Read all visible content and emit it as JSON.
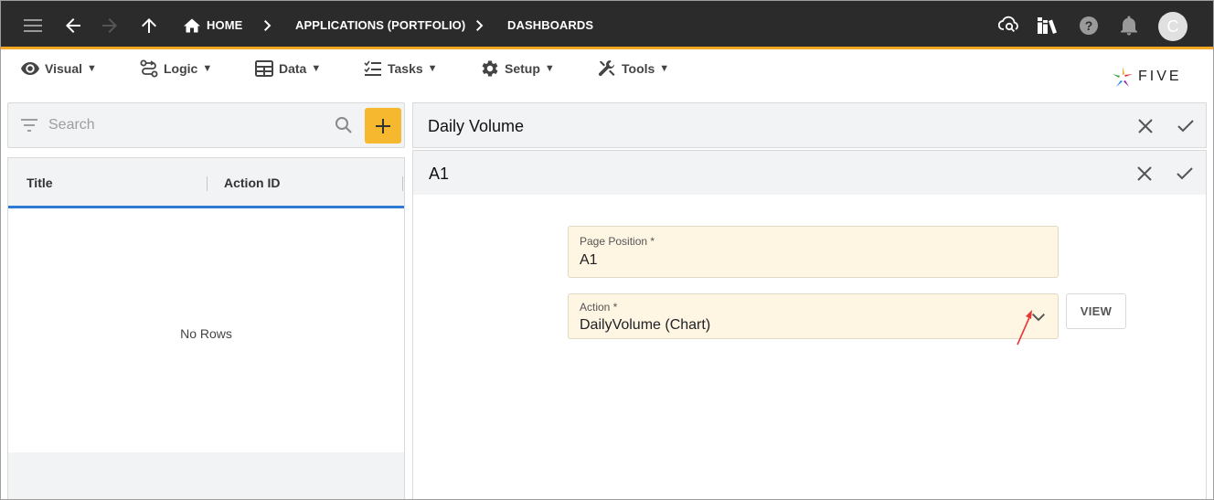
{
  "topbar": {
    "breadcrumbs": [
      "HOME",
      "APPLICATIONS (PORTFOLIO)",
      "DASHBOARDS"
    ],
    "avatar_initial": "C",
    "icons": [
      "menu-icon",
      "back-arrow-icon",
      "forward-arrow-icon",
      "up-arrow-icon",
      "home-icon",
      "cloud-search-icon",
      "books-icon",
      "help-icon",
      "bell-icon"
    ]
  },
  "menubar": {
    "items": [
      {
        "label": "Visual",
        "icon": "eye-icon"
      },
      {
        "label": "Logic",
        "icon": "logic-icon"
      },
      {
        "label": "Data",
        "icon": "table-icon"
      },
      {
        "label": "Tasks",
        "icon": "checklist-icon"
      },
      {
        "label": "Setup",
        "icon": "gear-icon"
      },
      {
        "label": "Tools",
        "icon": "tools-icon"
      }
    ],
    "caret": "▼",
    "logo_text": "FIVE"
  },
  "search": {
    "placeholder": "Search"
  },
  "list": {
    "columns": [
      "Title",
      "Action ID"
    ],
    "empty_text": "No Rows"
  },
  "panels": {
    "outer_title": "Daily Volume",
    "inner_title": "A1"
  },
  "form": {
    "page_position_label": "Page Position *",
    "page_position_value": "A1",
    "action_label": "Action *",
    "action_value": "DailyVolume (Chart)",
    "view_button": "VIEW"
  },
  "colors": {
    "topbar_bg": "#2b2b2b",
    "accent_orange": "#f5a623",
    "add_button": "#f5b82e",
    "list_underline": "#2e7bd6",
    "field_bg": "#fef5e2"
  }
}
